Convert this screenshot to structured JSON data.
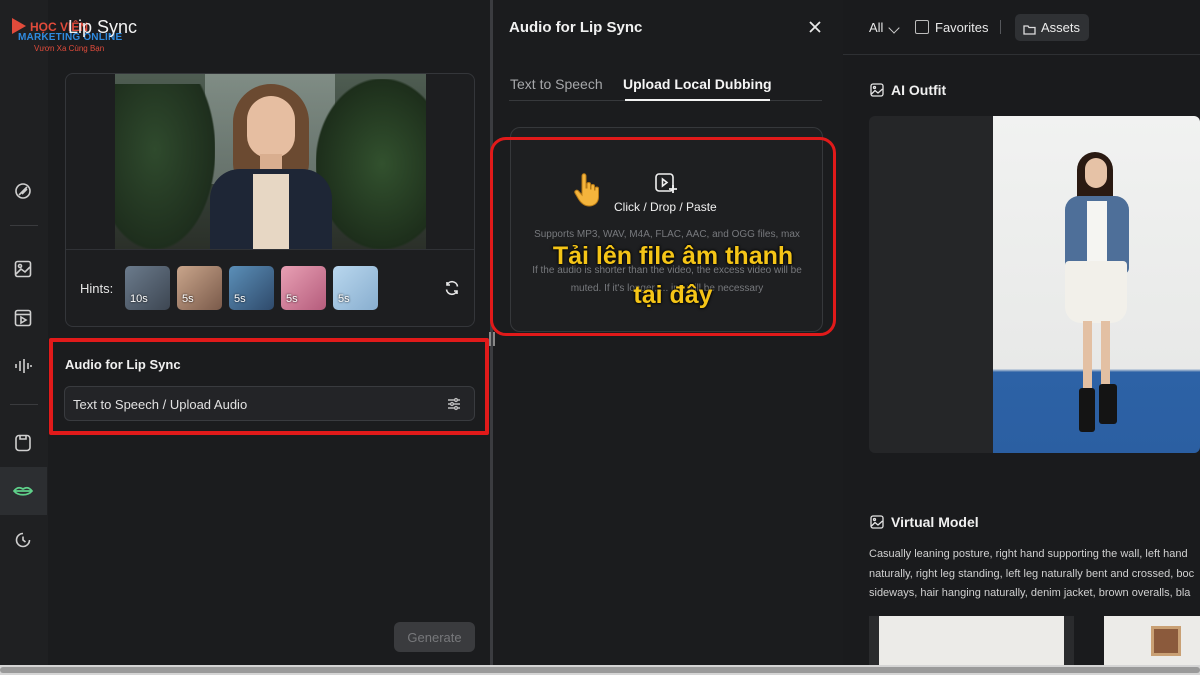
{
  "app": {
    "page_title": "Lip Sync",
    "logo_text_top": "HỌC VIỆN",
    "logo_text_main": "MARKETING ONLINE",
    "logo_text_sub": "Vươn Xa Cùng Bạn"
  },
  "rail": {
    "icons": [
      "magic-wand-icon",
      "image-icon",
      "video-icon",
      "audio-wave-icon",
      "avatar-icon",
      "lips-icon",
      "history-icon"
    ],
    "active": "lips-icon"
  },
  "left_panel": {
    "hints_label": "Hints:",
    "hints": [
      {
        "duration": "10s",
        "color_a": "#6b7b8c",
        "color_b": "#3d4652"
      },
      {
        "duration": "5s",
        "color_a": "#c9a58b",
        "color_b": "#7a5a4a"
      },
      {
        "duration": "5s",
        "color_a": "#5b8fb8",
        "color_b": "#2f4a6b"
      },
      {
        "duration": "5s",
        "color_a": "#e8a0b4",
        "color_b": "#b55c7c"
      },
      {
        "duration": "5s",
        "color_a": "#b9d7ee",
        "color_b": "#88aecf"
      }
    ],
    "audio_section_title": "Audio for Lip Sync",
    "audio_field_text": "Text to Speech / Upload Audio",
    "generate_label": "Generate"
  },
  "middle_panel": {
    "title": "Audio for Lip Sync",
    "tabs": [
      {
        "label": "Text to Speech",
        "active": false
      },
      {
        "label": "Upload Local Dubbing",
        "active": true
      }
    ],
    "drop_label": "Click / Drop / Paste",
    "drop_help_lines": [
      "Supports MP3, WAV, M4A, FLAC, AAC, and OGG files, max",
      "",
      "If the audio is shorter than the video, the excess video will be",
      "muted. If it's longer, ... ing will be necessary"
    ],
    "overlay_text_line1": "Tải lên file âm thanh",
    "overlay_text_line2": "tại đây"
  },
  "right_panel": {
    "filter_label": "All",
    "favorites_label": "Favorites",
    "assets_label": "Assets",
    "section1_title": "AI Outfit",
    "section2_title": "Virtual Model",
    "vm_description_lines": [
      "Casually leaning posture, right hand supporting the wall, left hand",
      "naturally, right leg standing, left leg naturally bent and crossed, boc",
      "sideways, hair hanging naturally, denim jacket, brown overalls, bla"
    ]
  },
  "colors": {
    "highlight_red": "#e11a1a",
    "overlay_yellow": "#f5c517",
    "background": "#1b1c1e"
  }
}
